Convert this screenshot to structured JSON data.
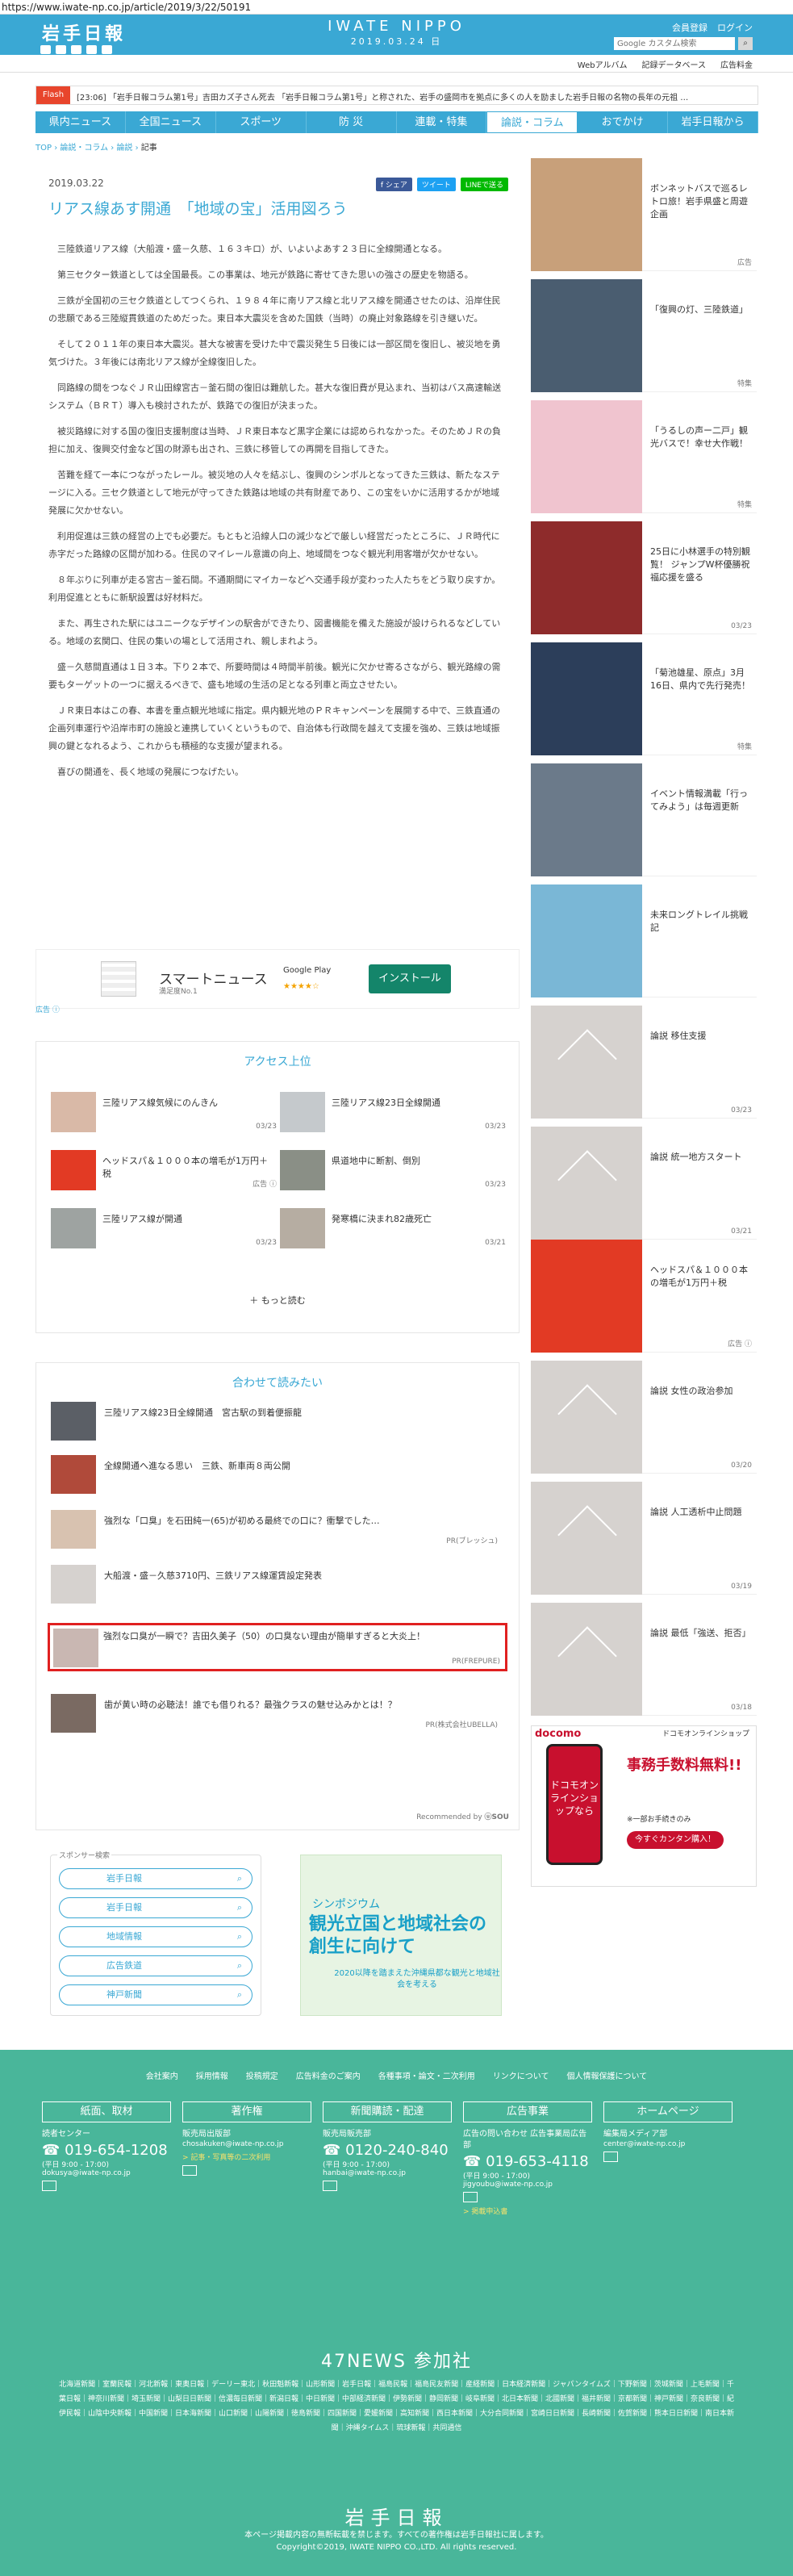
{
  "url": "https://www.iwate-np.co.jp/article/2019/3/22/50191",
  "header": {
    "logo": "岩手日報",
    "brand": "IWATE NIPPO",
    "date": "2019.03.24 日",
    "login": [
      "会員登録",
      "ログイン"
    ],
    "search_placeholder": "Google カスタム検索",
    "search_icon": "search-icon"
  },
  "subbar": [
    "Webアルバム",
    "記録データベース",
    "広告料金"
  ],
  "flash": {
    "tag": "Flash",
    "text": "[23:06] 「岩手日報コラム第1号」吉田カズ子さん死去  「岩手日報コラム第1号」と称された、岩手の盛岡市を拠点に多くの人を励ました岩手日報の名物の長年の元祖 …"
  },
  "nav": [
    "県内ニュース",
    "全国ニュース",
    "スポーツ",
    "防 災",
    "連載・特集",
    "論説・コラム",
    "おでかけ",
    "岩手日報から"
  ],
  "nav_active": 5,
  "breadcrumb": [
    "TOP",
    "論説・コラム",
    "論説",
    "記事"
  ],
  "article": {
    "date": "2019.03.22",
    "share": [
      "f シェア",
      "ツイート",
      "LINEで送る"
    ],
    "title": "リアス線あす開通　「地域の宝」活用図ろう",
    "paragraphs": [
      "三陸鉄道リアス線（大船渡・盛－久慈、１６３キロ）が、いよいよあす２３日に全線開通となる。",
      "第三セクター鉄道としては全国最長。この事業は、地元が鉄路に寄せてきた思いの強さの歴史を物語る。",
      "三鉄が全国初の三セク鉄道としてつくられ、１９８４年に南リアス線と北リアス線を開通させたのは、沿岸住民の悲願である三陸縦貫鉄道のためだった。東日本大震災を含めた国鉄（当時）の廃止対象路線を引き継いだ。",
      "そして２０１１年の東日本大震災。甚大な被害を受けた中で震災発生５日後には一部区間を復旧し、被災地を勇気づけた。３年後には南北リアス線が全線復旧した。",
      "同路線の間をつなぐＪＲ山田線宮古－釜石間の復旧は難航した。甚大な復旧費が見込まれ、当初はバス高速輸送システム（ＢＲＴ）導入も検討されたが、鉄路での復旧が決まった。",
      "被災路線に対する国の復旧支援制度は当時、ＪＲ東日本など黒字企業には認められなかった。そのためＪＲの負担に加え、復興交付金など国の財源も出され、三鉄に移管しての再開を目指してきた。",
      "苦難を経て一本につながったレール。被災地の人々を結ぶし、復興のシンボルとなってきた三鉄は、新たなステージに入る。三セク鉄道として地元が守ってきた鉄路は地域の共有財産であり、この宝をいかに活用するかが地域発展に欠かせない。",
      "利用促進は三鉄の経営の上でも必要だ。もともと沿線人口の減少などで厳しい経営だったところに、ＪＲ時代に赤字だった路線の区間が加わる。住民のマイレール意識の向上、地域間をつなぐ観光利用客増が欠かせない。",
      "８年ぶりに列車が走る宮古－釜石間。不通期間にマイカーなどへ交通手段が変わった人たちをどう取り戻すか。利用促進とともに新駅設置は好材料だ。",
      "また、再生された駅にはユニークなデザインの駅舎ができたり、図書機能を備えた施設が設けられるなどしている。地域の玄関口、住民の集いの場として活用され、親しまれよう。",
      "盛－久慈間直通は１日３本。下り２本で、所要時間は４時間半前後。観光に欠かせ寄るさながら、観光路線の需要もターゲットの一つに据えるべきで、盛も地域の生活の足となる列車と両立させたい。",
      "ＪＲ東日本はこの春、本書を重点観光地域に指定。県内観光地のＰＲキャンペーンを展開する中で、三鉄直通の企画列車運行や沿岸市町の施設と連携していくというもので、自治体も行政間を越えて支援を強め、三鉄は地域振興の鍵となれるよう、これからも積極的な支援が望まれる。",
      "喜びの開通を、長く地域の発展につなげたい。"
    ]
  },
  "smartnews": {
    "title": "スマートニュース",
    "sub": "満足度No.1",
    "store": "Google Play",
    "stars": "★★★★☆",
    "install": "インストール",
    "ad": "広告 ⓘ"
  },
  "access": {
    "title": "アクセス上位",
    "items": [
      {
        "text": "三陸リアス線気候にのんきん",
        "date": "03/23"
      },
      {
        "text": "三陸リアス線23日全線開通",
        "date": "03/23"
      },
      {
        "text": "ヘッドスパ＆１０００本の増毛が1万円＋税",
        "date": "広告 ⓘ"
      },
      {
        "text": "県道地中に断割、倒別",
        "date": "03/23"
      },
      {
        "text": "三陸リアス線が開通",
        "date": "03/23"
      },
      {
        "text": "発寒橋に決まれ82歳死亡",
        "date": "03/21"
      }
    ],
    "more": "もっと読む"
  },
  "related": {
    "title": "合わせて読みたい",
    "items": [
      {
        "text": "三陸リアス線23日全線開通　宮古駅の到着便振龍",
        "pr": ""
      },
      {
        "text": "全線開通へ進なる思い　三鉄、新車両８両公開",
        "pr": ""
      },
      {
        "text": "強烈な「口臭」を石田純一(65)が初める最終での口に？衝撃でした…",
        "pr": "PR(ブレッシュ)"
      },
      {
        "text": "大船渡・盛－久慈3710円、三鉄リアス線運賃設定発表",
        "pr": ""
      },
      {
        "text": "強烈な口臭が一瞬で？吉田久美子（50）の口臭ない理由が簡単すぎると大炎上！",
        "pr": "PR(FREPURE)"
      },
      {
        "text": "歯が黄い時の必聴法！誰でも借りれる？最強クラスの魅せ込みかとは！？",
        "pr": "PR(株式会社UBELLA)"
      }
    ],
    "powered": "Recommended by",
    "brand": "ⓤSOU"
  },
  "sponsor": {
    "label": "スポンサー検索",
    "items": [
      "岩手日報",
      "岩手日報",
      "地域情報",
      "広告鉄道",
      "神戸新聞"
    ]
  },
  "symposium": {
    "tag": "シンポジウム",
    "title": "観光立国と地域社会の創生に向けて",
    "sub": "2020以降を踏まえた沖縄県都な観光と地域社会を考える"
  },
  "sidebar": [
    {
      "text": "ボンネットバスで巡るレトロ旅！岩手県盛と周遊企画",
      "date": "広告"
    },
    {
      "text": "「復興の灯、三陸鉄道」",
      "date": "特集"
    },
    {
      "text": "「うるしの声ー二戸」観光バスで！幸せ大作戦！",
      "date": "特集"
    },
    {
      "text": "25日に小林選手の特別観覧！ ジャンプW杯優勝祝福応援を盛る",
      "date": "03/23"
    },
    {
      "text": "「菊池雄星、原点」3月16日、県内で先行発売！",
      "date": "特集"
    },
    {
      "text": "イベント情報満載「行ってみよう」は毎週更新",
      "date": ""
    },
    {
      "text": "未来ロングトレイル挑戦記",
      "date": ""
    },
    {
      "text": "論説 移住支援",
      "date": "03/23"
    },
    {
      "text": "論説 統一地方スタート",
      "date": "03/21"
    },
    {
      "text": "ヘッドスパ＆１０００本の増毛が1万円＋税",
      "date": "広告 ⓘ"
    },
    {
      "text": "論説 女性の政治参加",
      "date": "03/20"
    },
    {
      "text": "論説 人工透析中止問題",
      "date": "03/19"
    },
    {
      "text": "論説 最低「強送、拒否」",
      "date": "03/18"
    }
  ],
  "docomo": {
    "brand": "docomo",
    "shop": "ドコモオンラインショップ",
    "phone": "ドコモオンラインショップなら",
    "headline": "事務手数料無料!!",
    "sub": "※一部お手続きのみ",
    "button": "今すぐカンタン購入！"
  },
  "footer": {
    "links": [
      "会社案内",
      "採用情報",
      "投稿規定",
      "広告料金のご案内",
      "各種事項・論文・二次利用",
      "リンクについて",
      "個人情報保護について"
    ],
    "cols": [
      {
        "head": "紙面、取材",
        "label": "読者センター",
        "tel": "019-654-1208",
        "hours": "(平日 9:00 - 17:00)",
        "mail": "dokusya@iwate-np.co.jp"
      },
      {
        "head": "著作権",
        "label": "販売局出版部",
        "tel": "",
        "hours": "",
        "mail": "chosakuken@iwate-np.co.jp"
      },
      {
        "head": "新聞購読・配達",
        "label": "販売局販売部",
        "tel": "0120-240-840",
        "hours": "(平日 9:00 - 17:00)",
        "mail": "hanbai@iwate-np.co.jp"
      },
      {
        "head": "広告事業",
        "label": "広告の問い合わせ 広告事業局広告部",
        "tel": "019-653-4118",
        "hours": "(平日 9:00 - 17:00)",
        "mail": "jigyoubu@iwate-np.co.jp"
      },
      {
        "head": "ホームページ",
        "label": "編集局メディア部",
        "tel": "",
        "hours": "",
        "mail": "center@iwate-np.co.jp"
      }
    ],
    "copyright_link": "> 記事・写真等の二次利用",
    "ad_link": "> 掲載申込書",
    "news47": "47NEWS 参加社",
    "papers": "北海道新聞｜室蘭民報｜河北新報｜東奥日報｜デーリー東北｜秋田魁新報｜山形新聞｜岩手日報｜福島民報｜福島民友新聞｜産経新聞｜日本経済新聞｜ジャパンタイムズ｜下野新聞｜茨城新聞｜上毛新聞｜千葉日報｜神奈川新聞｜埼玉新聞｜山梨日日新聞｜信濃毎日新聞｜新潟日報｜中日新聞｜中部経済新聞｜伊勢新聞｜静岡新聞｜岐阜新聞｜北日本新聞｜北國新聞｜福井新聞｜京都新聞｜神戸新聞｜奈良新聞｜紀伊民報｜山陰中央新報｜中国新聞｜日本海新聞｜山口新聞｜山陽新聞｜徳島新聞｜四国新聞｜愛媛新聞｜高知新聞｜西日本新聞｜大分合同新聞｜宮崎日日新聞｜長崎新聞｜佐賀新聞｜熊本日日新聞｜南日本新聞｜沖縄タイムス｜琉球新報｜共同通信",
    "logo": "岩手日報",
    "note": "本ページ掲載内容の無断転載を禁じます。すべての著作権は岩手日報社に属します。",
    "copyright": "Copyright©2019, IWATE NIPPO CO.,LTD. All rights reserved."
  }
}
